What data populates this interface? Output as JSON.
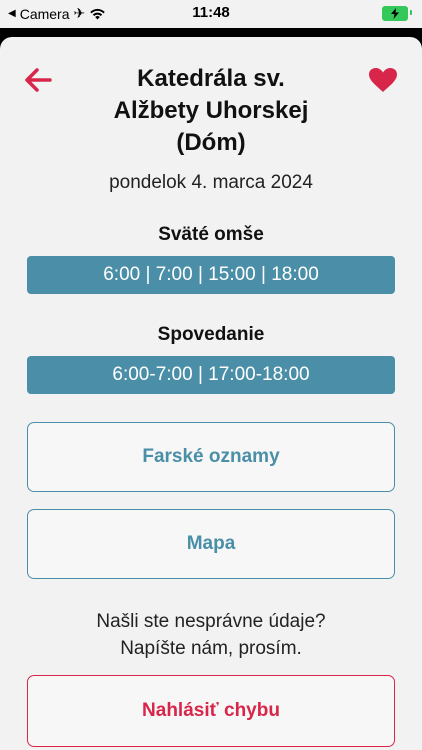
{
  "status_bar": {
    "back_app": "Camera",
    "time": "11:48",
    "icons": [
      "back-triangle-icon",
      "airplane-icon",
      "wifi-icon",
      "battery-charging-icon"
    ]
  },
  "header": {
    "title": "Katedrála sv.\nAlžbety Uhorskej\n(Dóm)",
    "back_icon": "arrow-left-icon",
    "favorite_icon": "heart-icon"
  },
  "date": "pondelok 4. marca 2024",
  "masses": {
    "title": "Sväté omše",
    "times": "6:00 | 7:00 | 15:00 | 18:00"
  },
  "confession": {
    "title": "Spovedanie",
    "times": "6:00-7:00 | 17:00-18:00"
  },
  "buttons": {
    "announcements": "Farské oznamy",
    "map": "Mapa"
  },
  "report": {
    "line1": "Našli ste nesprávne údaje?",
    "line2": "Napíšte nám, prosím.",
    "button": "Nahlásiť chybu"
  },
  "colors": {
    "accent_red": "#d8264b",
    "accent_teal": "#4a8fa7",
    "background": "#f2f2f2"
  }
}
